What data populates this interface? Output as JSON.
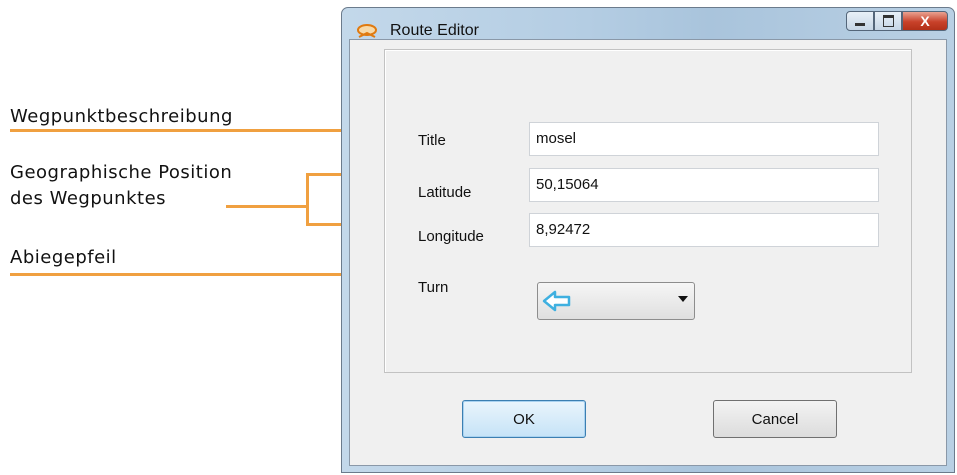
{
  "annotations": {
    "waypoint_description": "Wegpunktbeschreibung",
    "geo_position_line1": "Geographische Position",
    "geo_position_line2": "des Wegpunktes",
    "turn_arrow": "Abiegepfeil"
  },
  "window": {
    "title": "Route Editor",
    "close_glyph": "X"
  },
  "form": {
    "title_label": "Title",
    "title_value": "mosel",
    "latitude_label": "Latitude",
    "latitude_value": "50,15064",
    "longitude_label": "Longitude",
    "longitude_value": "8,92472",
    "turn_label": "Turn",
    "turn_selected_icon": "turn-left-arrow-icon"
  },
  "buttons": {
    "ok": "OK",
    "cancel": "Cancel"
  },
  "colors": {
    "annotation_line": "#f0a040",
    "turn_arrow": "#3fb0e0"
  }
}
